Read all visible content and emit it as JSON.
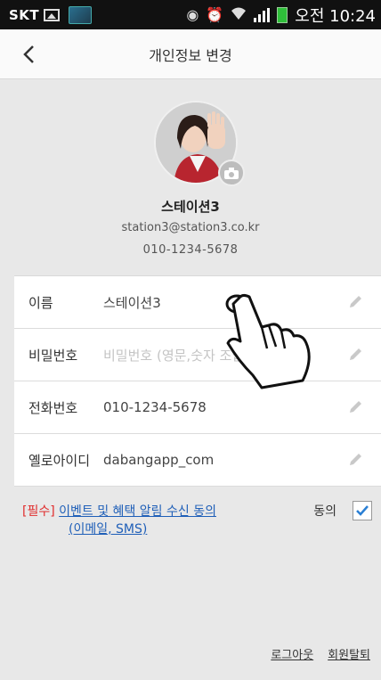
{
  "statusbar": {
    "carrier": "SKT",
    "time": "오전 10:24"
  },
  "header": {
    "title": "개인정보 변경",
    "back_icon": "chevron-left-icon"
  },
  "profile": {
    "name": "스테이션3",
    "email": "station3@station3.co.kr",
    "phone": "010-1234-5678",
    "camera_icon": "camera-icon"
  },
  "form": {
    "rows": [
      {
        "label": "이름",
        "value": "스테이션3",
        "placeholder": ""
      },
      {
        "label": "비밀번호",
        "value": "",
        "placeholder": "비밀번호 (영문,숫자 조합 6~12자)"
      },
      {
        "label": "전화번호",
        "value": "010-1234-5678",
        "placeholder": ""
      },
      {
        "label": "옐로아이디",
        "value": "dabangapp_com",
        "placeholder": ""
      }
    ]
  },
  "consent": {
    "required_tag": "[필수]",
    "text_line1": "이벤트 및 혜택 알림 수신 동의",
    "text_line2": "(이메일, SMS)",
    "agree_label": "동의",
    "checked": true
  },
  "footer": {
    "logout": "로그아웃",
    "withdraw": "회원탈퇴"
  },
  "colors": {
    "required": "#e02d2d",
    "link": "#1f5fb8",
    "check": "#2a7fd4"
  }
}
